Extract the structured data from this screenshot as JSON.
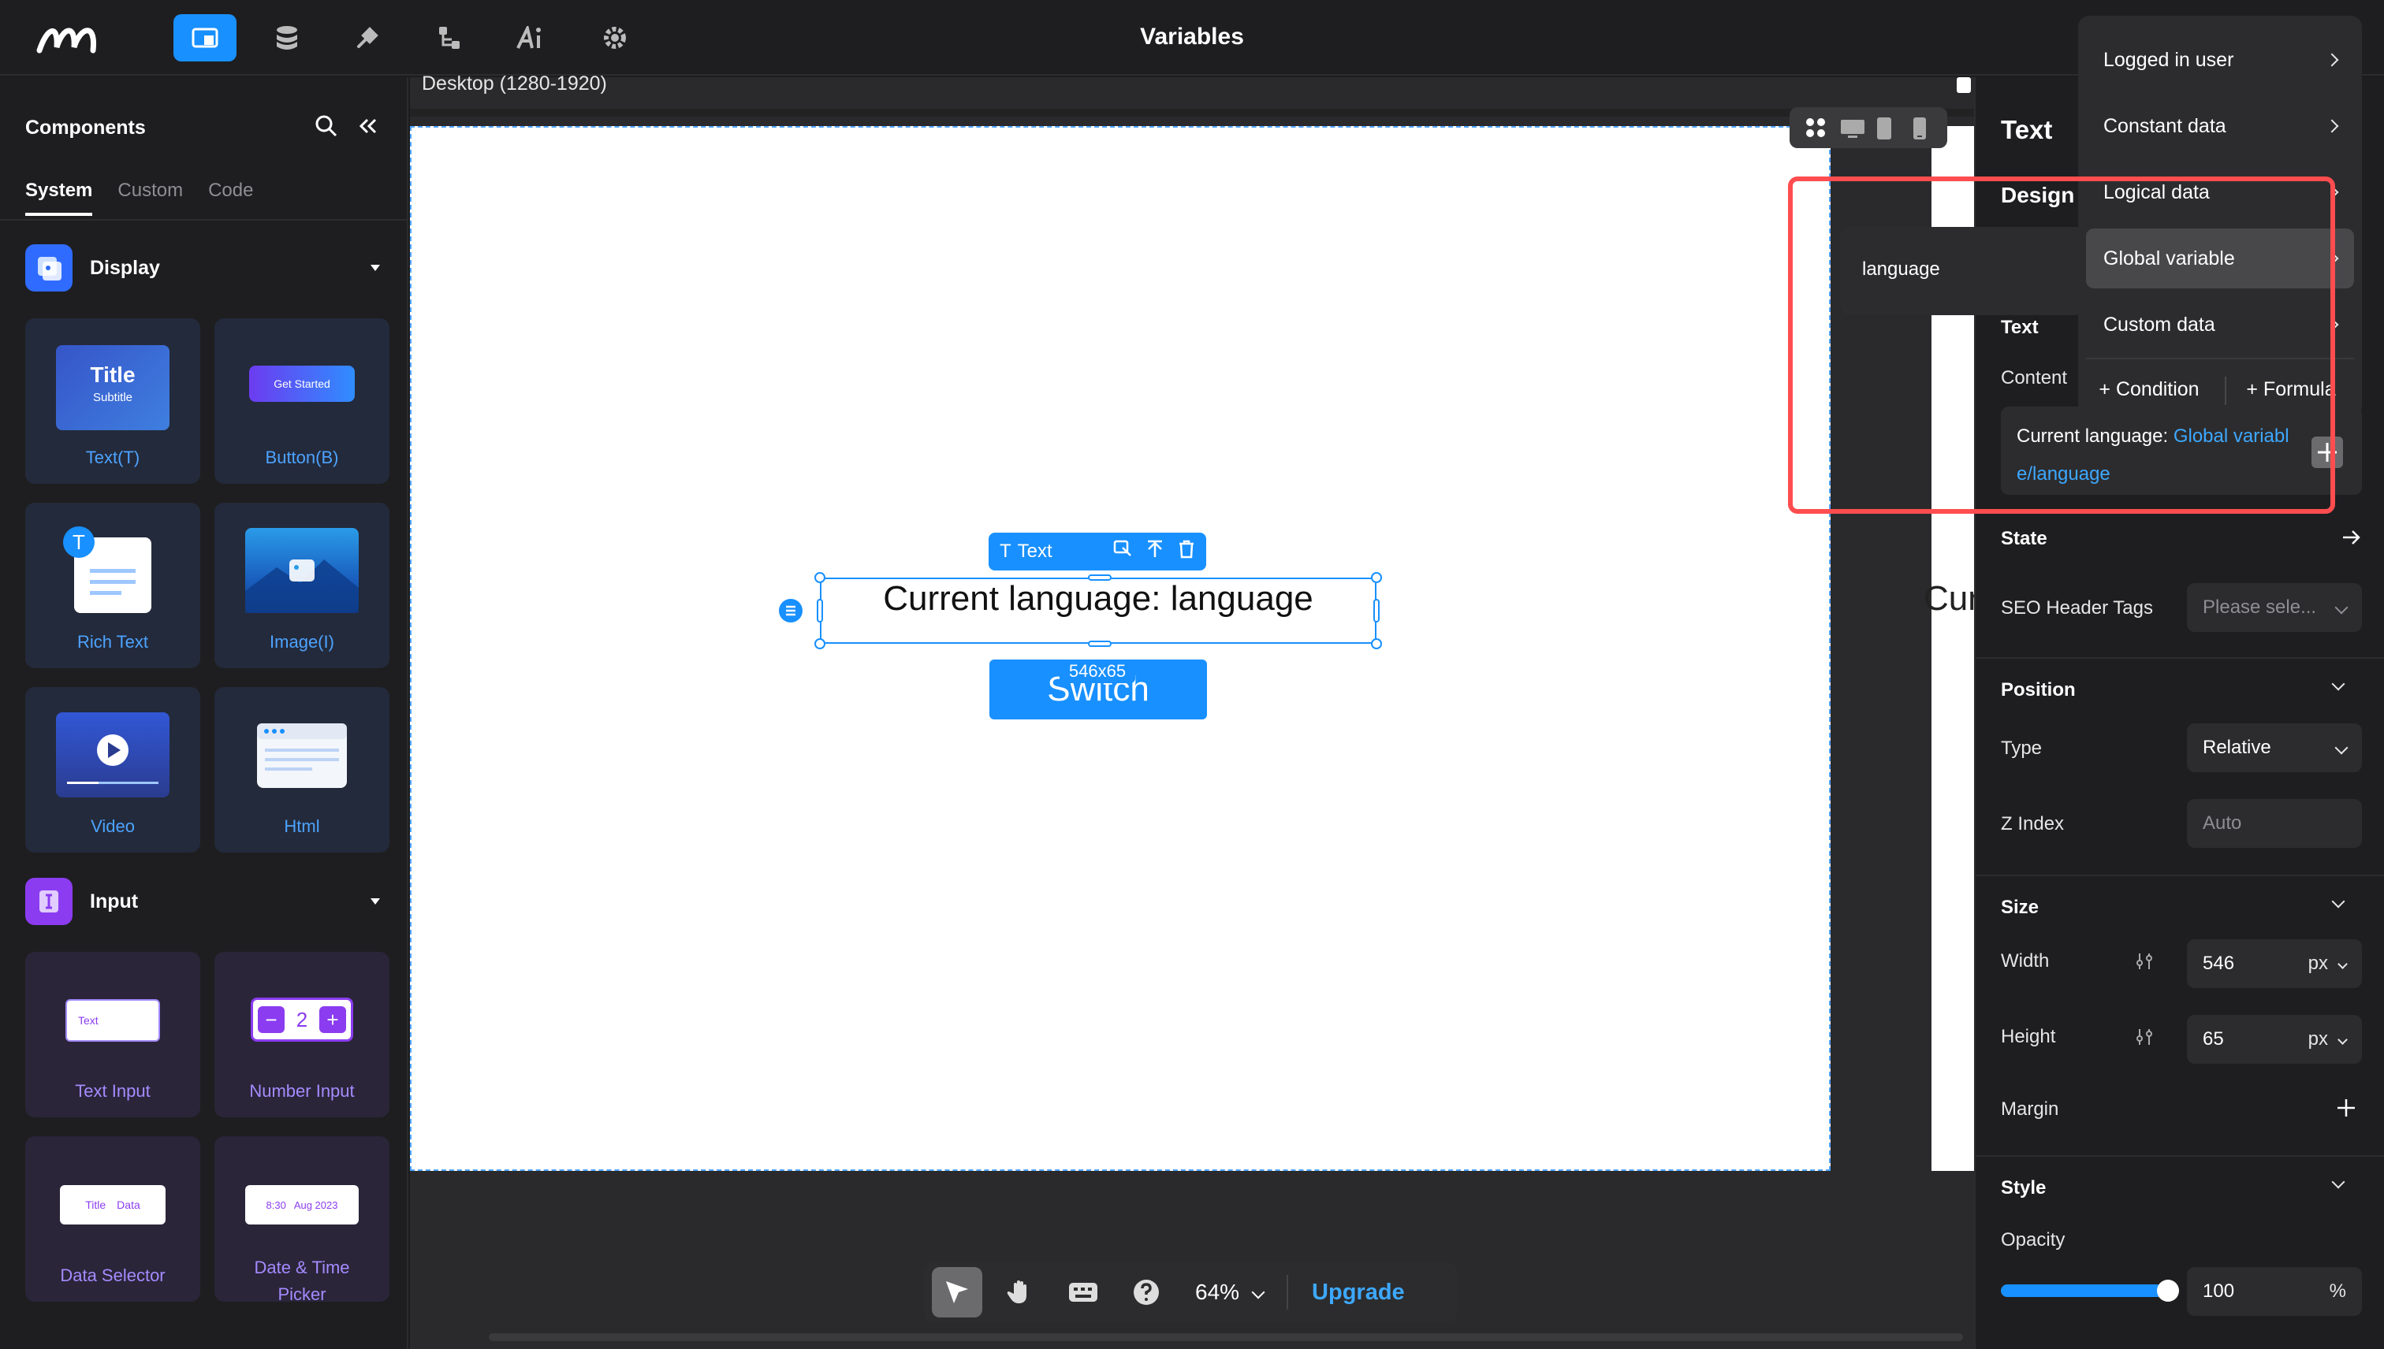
{
  "app": {
    "title": "Variables",
    "nav_icons": [
      "pages-icon",
      "database-icon",
      "plugin-icon",
      "workflow-icon",
      "ai-icon",
      "settings-icon"
    ]
  },
  "components_panel": {
    "title": "Components",
    "tabs": [
      "System",
      "Custom",
      "Code"
    ],
    "sections": [
      {
        "label": "Display",
        "items": [
          {
            "label": "Text(T)",
            "thumb_title": "Title",
            "thumb_subtitle": "Subtitle"
          },
          {
            "label": "Button(B)",
            "thumb_text": "Get Started"
          },
          {
            "label": "Rich Text"
          },
          {
            "label": "Image(I)"
          },
          {
            "label": "Video"
          },
          {
            "label": "Html"
          }
        ]
      },
      {
        "label": "Input",
        "items": [
          {
            "label": "Text Input",
            "thumb_text": "Text"
          },
          {
            "label": "Number Input",
            "thumb_value": "2"
          },
          {
            "label": "Data Selector",
            "thumb_title": "Title",
            "thumb_data": "Data"
          },
          {
            "label": "Date & Time Picker",
            "thumb_time": "8:30",
            "thumb_date": "Aug 2023"
          }
        ]
      }
    ]
  },
  "canvas": {
    "device_label": "Desktop (1280-1920)",
    "selected_text": "Current language: language",
    "element_toolbar_label": "Text",
    "size_badge": "546x65",
    "button_label": "Switch",
    "side_preview_text": "Curr",
    "zoom": "64%",
    "upgrade_label": "Upgrade"
  },
  "properties_panel": {
    "title": "Text",
    "tab_design": "Design",
    "text_section": "Text",
    "content_label": "Content",
    "content_prefix": "Current language:",
    "content_var_line1": "Global variabl",
    "content_var_line2": "e/language",
    "state_label": "State",
    "seo_label": "SEO Header Tags",
    "seo_placeholder": "Please sele...",
    "position_section": "Position",
    "type_label": "Type",
    "type_value": "Relative",
    "zindex_label": "Z Index",
    "zindex_placeholder": "Auto",
    "size_section": "Size",
    "width_label": "Width",
    "width_value": "546",
    "width_unit": "px",
    "height_label": "Height",
    "height_value": "65",
    "height_unit": "px",
    "margin_label": "Margin",
    "style_section": "Style",
    "opacity_label": "Opacity",
    "opacity_value": "100",
    "opacity_unit": "%",
    "opacity_level": 1.0
  },
  "data_menu": {
    "items": [
      "Logged in user",
      "Constant data",
      "Logical data",
      "Global variable",
      "Custom data"
    ],
    "hovered": "Global variable",
    "footer_condition": "+ Condition",
    "footer_formula": "+ Formula",
    "submenu_items": [
      "language"
    ]
  },
  "colors": {
    "accent": "#1890ff",
    "highlight_outline": "#ff4d4f",
    "panel_bg": "#1e1e20"
  }
}
